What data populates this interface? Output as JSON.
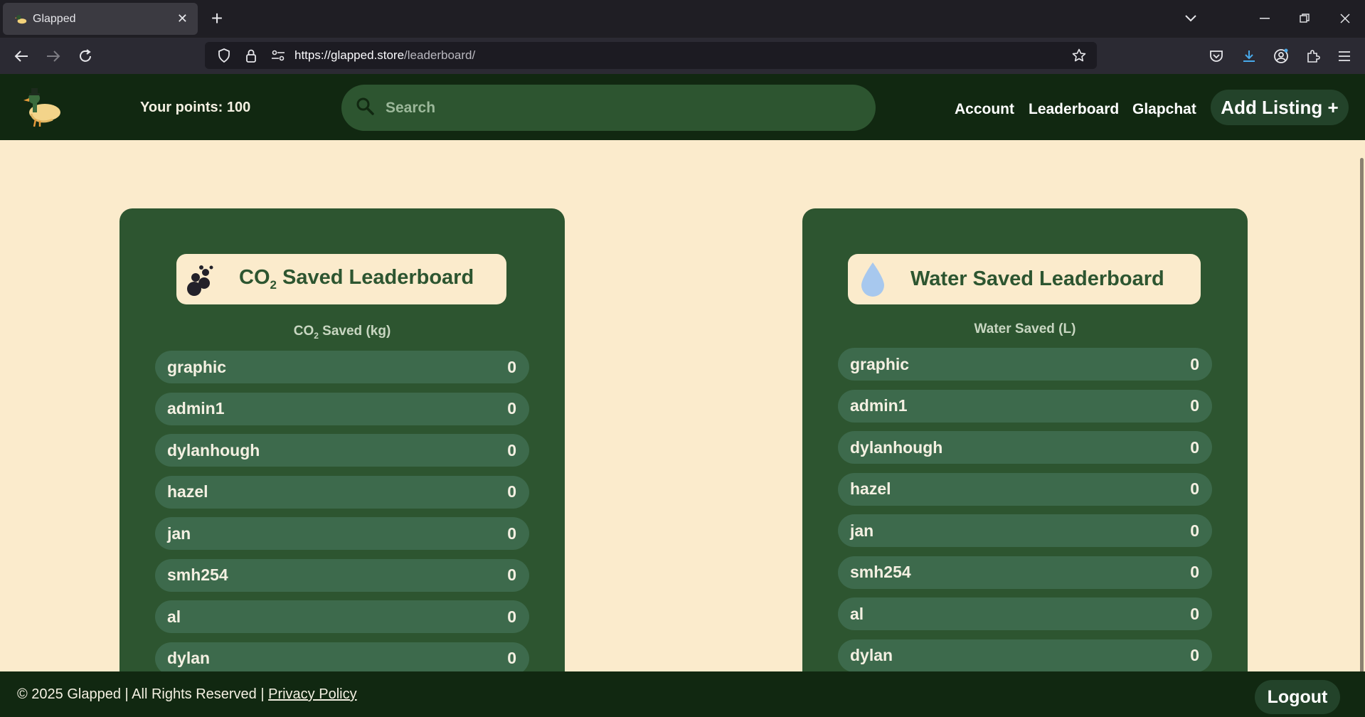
{
  "browser": {
    "tab_title": "Glapped",
    "url_host": "https://glapped.store",
    "url_path": "/leaderboard/"
  },
  "header": {
    "points": "Your points: 100",
    "search_placeholder": "Search",
    "nav": [
      "Account",
      "Leaderboard",
      "Glapchat"
    ],
    "add_listing": "Add Listing +"
  },
  "co2_board": {
    "title_prefix": "CO",
    "title_sub": "2",
    "title_suffix": " Saved Leaderboard",
    "subtitle_prefix": "CO",
    "subtitle_sub": "2",
    "subtitle_suffix": " Saved (kg)",
    "rows": [
      {
        "name": "graphic",
        "value": "0"
      },
      {
        "name": "admin1",
        "value": "0"
      },
      {
        "name": "dylanhough",
        "value": "0"
      },
      {
        "name": "hazel",
        "value": "0"
      },
      {
        "name": "jan",
        "value": "0"
      },
      {
        "name": "smh254",
        "value": "0"
      },
      {
        "name": "al",
        "value": "0"
      },
      {
        "name": "dylan",
        "value": "0"
      }
    ]
  },
  "water_board": {
    "title": "Water Saved Leaderboard",
    "subtitle": "Water Saved (L)",
    "rows": [
      {
        "name": "graphic",
        "value": "0"
      },
      {
        "name": "admin1",
        "value": "0"
      },
      {
        "name": "dylanhough",
        "value": "0"
      },
      {
        "name": "hazel",
        "value": "0"
      },
      {
        "name": "jan",
        "value": "0"
      },
      {
        "name": "smh254",
        "value": "0"
      },
      {
        "name": "al",
        "value": "0"
      },
      {
        "name": "dylan",
        "value": "0"
      }
    ]
  },
  "footer": {
    "copyright": "© 2025 Glapped | All Rights Reserved | ",
    "privacy": "Privacy Policy",
    "logout": "Logout"
  },
  "colors": {
    "header_bg": "#112811",
    "card_bg": "#2d5530",
    "row_bg": "#3d6a4c",
    "page_bg": "#fbebcc"
  }
}
